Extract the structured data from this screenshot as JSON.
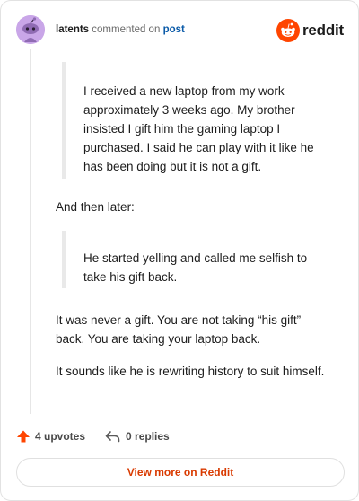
{
  "header": {
    "author": "latents",
    "action_text": "commented on",
    "post_link": "post",
    "brand_word": "reddit"
  },
  "comment": {
    "quote1": "I received a new laptop from my work approximately 3 weeks ago. My brother insisted I gift him the gaming laptop I purchased. I said he can play with it like he has been doing but it is not a gift.",
    "and_then_later": "And then later:",
    "quote2": "He started yelling and called me selfish to take his gift back.",
    "paragraph1": "It was never a gift. You are not taking “his gift” back. You are taking your laptop back.",
    "paragraph2": "It sounds like he is rewriting history to suit himself."
  },
  "actions": {
    "upvotes_label": "4 upvotes",
    "replies_label": "0 replies",
    "upvote_icon": "upvote-arrow-icon",
    "reply_icon": "reply-arrow-icon"
  },
  "footer": {
    "view_more_label": "View more on Reddit"
  },
  "colors": {
    "brand_orange": "#ff4500",
    "upvote_orange": "#ff4500",
    "view_more_text": "#d93a00",
    "link_blue": "#0a5aa8",
    "avatar_purple": "#c9a6e8"
  }
}
